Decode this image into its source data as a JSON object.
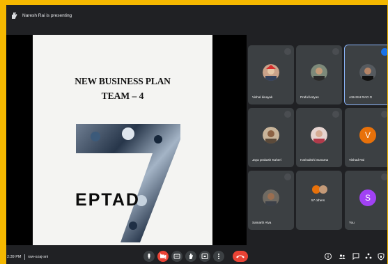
{
  "header": {
    "presenting_text": "Naresh Rai is presenting"
  },
  "slide": {
    "line1": "NEW BUSINESS PLAN",
    "line2": "TEAM – 4",
    "logo_text": "HEPTAD"
  },
  "participants": [
    {
      "name": "Vishal kinayak",
      "mic": "off",
      "avatar": "photo"
    },
    {
      "name": "Praful kotyan",
      "mic": "off",
      "avatar": "photo"
    },
    {
      "name": "ASHISH RAO G",
      "mic": "speaking",
      "avatar": "photo"
    },
    {
      "name": "Jaya prakash Kaheri",
      "mic": "off",
      "avatar": "photo"
    },
    {
      "name": "Harinakshi Sunama",
      "mic": "off",
      "avatar": "photo"
    },
    {
      "name": "Vishad Rai",
      "mic": "off",
      "avatar": "letter",
      "letter": "V",
      "color": "#e8710a"
    },
    {
      "name": "Samarth Alva",
      "mic": "off",
      "avatar": "photo"
    },
    {
      "name": "57 others",
      "avatar": "group"
    },
    {
      "name": "You",
      "mic": "off",
      "avatar": "letter",
      "letter": "S",
      "color": "#a142f4"
    }
  ],
  "footer": {
    "time": "2:39 PM",
    "meeting_code": "rsw-ozaj-sni",
    "people_badge": "65"
  },
  "colors": {
    "frame": "#f5b800",
    "background": "#202124",
    "tile": "#3c4043",
    "end_call": "#ea4335",
    "accent": "#8ab4f8"
  }
}
